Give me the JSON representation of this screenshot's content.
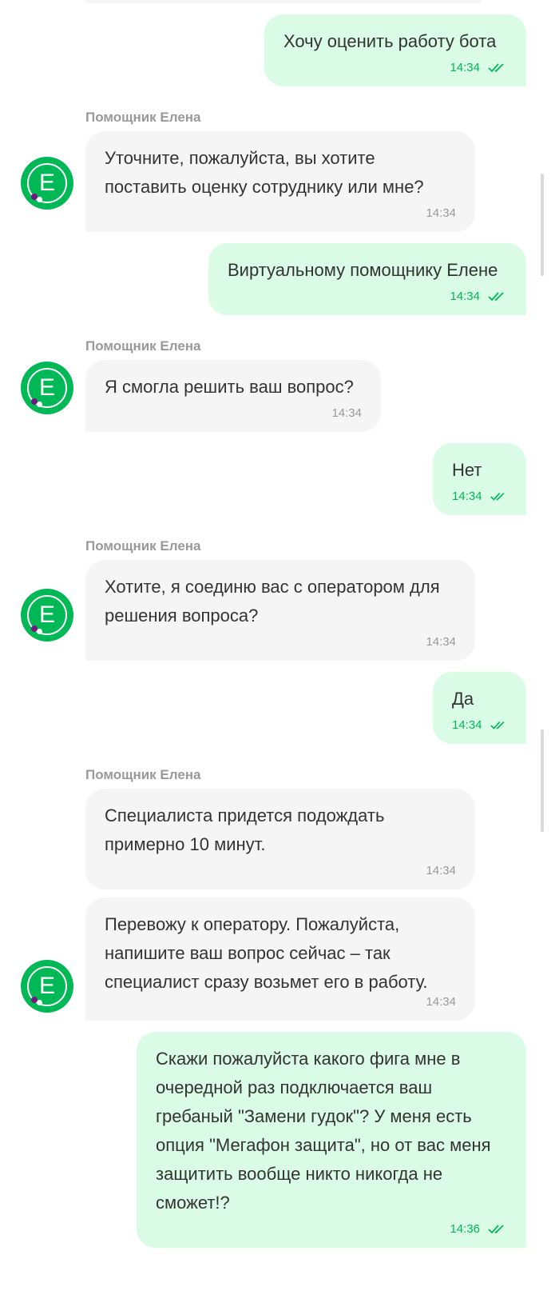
{
  "bot": {
    "sender_name": "Помощник Елена",
    "avatar_letter": "Е"
  },
  "messages": [
    {
      "from": "user",
      "text": "Хочу оценить работу бота",
      "time": "14:34"
    },
    {
      "from": "bot",
      "text": "Уточните, пожалуйста, вы хотите поставить оценку сотруднику или мне?",
      "time": "14:34"
    },
    {
      "from": "user",
      "text": "Виртуальному помощнику Елене",
      "time": "14:34"
    },
    {
      "from": "bot",
      "text": "Я смогла решить ваш вопрос?",
      "time": "14:34"
    },
    {
      "from": "user",
      "text": "Нет",
      "time": "14:34"
    },
    {
      "from": "bot",
      "text": "Хотите, я соединю вас с оператором для решения вопроса?",
      "time": "14:34"
    },
    {
      "from": "user",
      "text": "Да",
      "time": "14:34"
    },
    {
      "from": "bot",
      "text": "Специалиста придется подождать примерно 10 минут.",
      "time": "14:34"
    },
    {
      "from": "bot",
      "text": "Перевожу к оператору. Пожалуйста, напишите ваш вопрос сейчас – так специалист сразу возьмет его в работу.",
      "time": "14:34"
    },
    {
      "from": "user",
      "text": "Скажи пожалуйста какого фига мне в очередной раз подключается ваш гребаный \"Замени гудок\"? У меня есть опция \"Мегафон защита\", но от вас меня защитить вообще никто никогда не сможет!?",
      "time": "14:36"
    }
  ],
  "colors": {
    "brand_green": "#00b956",
    "user_bubble": "#dafbe6",
    "bot_bubble": "#f5f5f5",
    "brand_purple": "#731982"
  },
  "icons": {
    "read_status": "double-check-icon",
    "avatar": "megafon-e-avatar-icon"
  }
}
